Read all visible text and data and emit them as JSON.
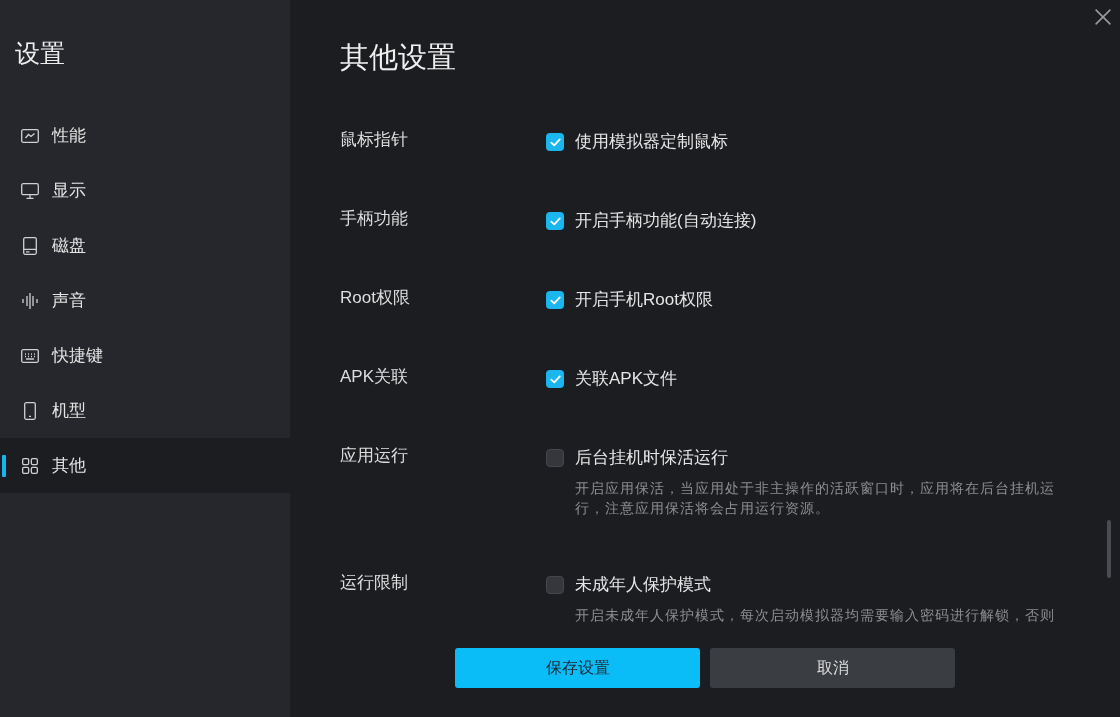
{
  "sidebar": {
    "title": "设置",
    "items": [
      {
        "label": "性能",
        "selected": false
      },
      {
        "label": "显示",
        "selected": false
      },
      {
        "label": "磁盘",
        "selected": false
      },
      {
        "label": "声音",
        "selected": false
      },
      {
        "label": "快捷键",
        "selected": false
      },
      {
        "label": "机型",
        "selected": false
      },
      {
        "label": "其他",
        "selected": true
      }
    ]
  },
  "panel": {
    "title": "其他设置",
    "settings": [
      {
        "label": "鼠标指针",
        "option": "使用模拟器定制鼠标",
        "checked": true
      },
      {
        "label": "手柄功能",
        "option": "开启手柄功能(自动连接)",
        "checked": true
      },
      {
        "label": "Root权限",
        "option": "开启手机Root权限",
        "checked": true
      },
      {
        "label": "APK关联",
        "option": "关联APK文件",
        "checked": true
      },
      {
        "label": "应用运行",
        "option": "后台挂机时保活运行",
        "checked": false,
        "description": "开启应用保活，当应用处于非主操作的活跃窗口时，应用将在后台挂机运行，注意应用保活将会占用运行资源。"
      },
      {
        "label": "运行限制",
        "option": "未成年人保护模式",
        "checked": false,
        "description": "开启未成年人保护模式，每次启动模拟器均需要输入密码进行解锁，否则"
      }
    ]
  },
  "buttons": [
    {
      "label": "保存设置",
      "kind": "primary"
    },
    {
      "label": "取消",
      "kind": "secondary"
    }
  ]
}
